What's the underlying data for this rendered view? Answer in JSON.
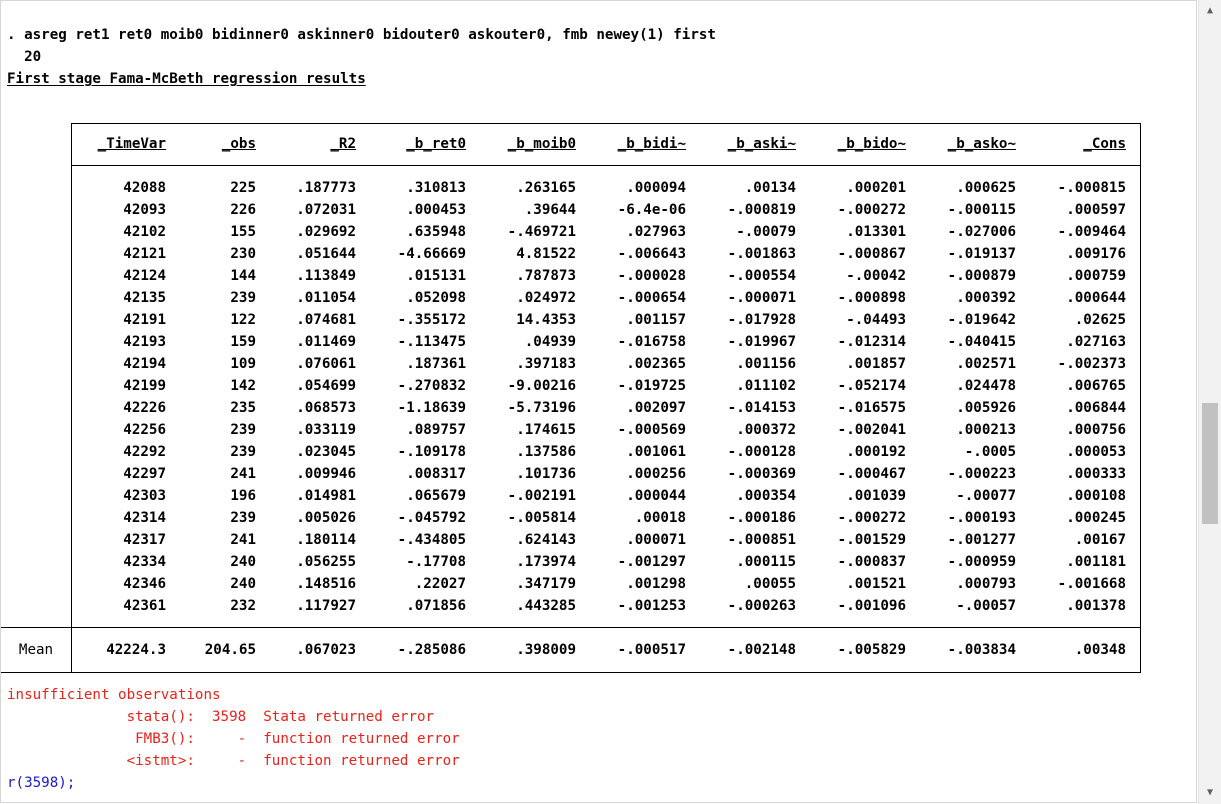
{
  "console": {
    "command": ". asreg ret1 ret0 moib0 bidinner0 askinner0 bidouter0 askouter0, fmb newey(1) first",
    "periods": "  20",
    "heading": "First stage Fama-McBeth regression results"
  },
  "table": {
    "columns": [
      "_TimeVar",
      "_obs",
      "_R2",
      "_b_ret0",
      "_b_moib0",
      "_b_bidi~",
      "_b_aski~",
      "_b_bido~",
      "_b_asko~",
      "_Cons"
    ],
    "rows": [
      [
        "42088",
        "225",
        ".187773",
        ".310813",
        ".263165",
        ".000094",
        ".00134",
        ".000201",
        ".000625",
        "-.000815"
      ],
      [
        "42093",
        "226",
        ".072031",
        ".000453",
        ".39644",
        "-6.4e-06",
        "-.000819",
        "-.000272",
        "-.000115",
        ".000597"
      ],
      [
        "42102",
        "155",
        ".029692",
        ".635948",
        "-.469721",
        ".027963",
        "-.00079",
        ".013301",
        "-.027006",
        "-.009464"
      ],
      [
        "42121",
        "230",
        ".051644",
        "-4.66669",
        "4.81522",
        "-.006643",
        "-.001863",
        "-.000867",
        "-.019137",
        ".009176"
      ],
      [
        "42124",
        "144",
        ".113849",
        ".015131",
        ".787873",
        "-.000028",
        "-.000554",
        "-.00042",
        "-.000879",
        ".000759"
      ],
      [
        "42135",
        "239",
        ".011054",
        ".052098",
        ".024972",
        "-.000654",
        "-.000071",
        "-.000898",
        ".000392",
        ".000644"
      ],
      [
        "42191",
        "122",
        ".074681",
        "-.355172",
        "14.4353",
        ".001157",
        "-.017928",
        "-.04493",
        "-.019642",
        ".02625"
      ],
      [
        "42193",
        "159",
        ".011469",
        "-.113475",
        ".04939",
        "-.016758",
        "-.019967",
        "-.012314",
        "-.040415",
        ".027163"
      ],
      [
        "42194",
        "109",
        ".076061",
        ".187361",
        ".397183",
        ".002365",
        ".001156",
        ".001857",
        ".002571",
        "-.002373"
      ],
      [
        "42199",
        "142",
        ".054699",
        "-.270832",
        "-9.00216",
        "-.019725",
        ".011102",
        "-.052174",
        ".024478",
        ".006765"
      ],
      [
        "42226",
        "235",
        ".068573",
        "-1.18639",
        "-5.73196",
        ".002097",
        "-.014153",
        "-.016575",
        ".005926",
        ".006844"
      ],
      [
        "42256",
        "239",
        ".033119",
        ".089757",
        ".174615",
        "-.000569",
        ".000372",
        "-.002041",
        ".000213",
        ".000756"
      ],
      [
        "42292",
        "239",
        ".023045",
        "-.109178",
        ".137586",
        ".001061",
        "-.000128",
        ".000192",
        "-.0005",
        ".000053"
      ],
      [
        "42297",
        "241",
        ".009946",
        ".008317",
        ".101736",
        ".000256",
        "-.000369",
        "-.000467",
        "-.000223",
        ".000333"
      ],
      [
        "42303",
        "196",
        ".014981",
        ".065679",
        "-.002191",
        ".000044",
        ".000354",
        ".001039",
        "-.00077",
        ".000108"
      ],
      [
        "42314",
        "239",
        ".005026",
        "-.045792",
        "-.005814",
        ".00018",
        "-.000186",
        "-.000272",
        "-.000193",
        ".000245"
      ],
      [
        "42317",
        "241",
        ".180114",
        "-.434805",
        ".624143",
        ".000071",
        "-.000851",
        "-.001529",
        "-.001277",
        ".00167"
      ],
      [
        "42334",
        "240",
        ".056255",
        "-.17708",
        ".173974",
        "-.001297",
        ".000115",
        "-.000837",
        "-.000959",
        ".001181"
      ],
      [
        "42346",
        "240",
        ".148516",
        ".22027",
        ".347179",
        ".001298",
        ".00055",
        ".001521",
        ".000793",
        "-.001668"
      ],
      [
        "42361",
        "232",
        ".117927",
        ".071856",
        ".443285",
        "-.001253",
        "-.000263",
        "-.001096",
        "-.00057",
        ".001378"
      ]
    ],
    "mean_label": "Mean",
    "mean": [
      "42224.3",
      "204.65",
      ".067023",
      "-.285086",
      ".398009",
      "-.000517",
      "-.002148",
      "-.005829",
      "-.003834",
      ".00348"
    ]
  },
  "errors": {
    "line1": "insufficient observations",
    "line2": "              stata():  3598  Stata returned error",
    "line3": "               FMB3():     -  function returned error",
    "line4": "              <istmt>:     -  function returned error",
    "rc": "r(3598);"
  },
  "colors": {
    "error": "#e8221c",
    "rc": "#1a1acd",
    "scrollbar_thumb": "#c1c1c1"
  },
  "scrollbar": {
    "up_icon": "triangle-up",
    "down_icon": "triangle-down"
  }
}
